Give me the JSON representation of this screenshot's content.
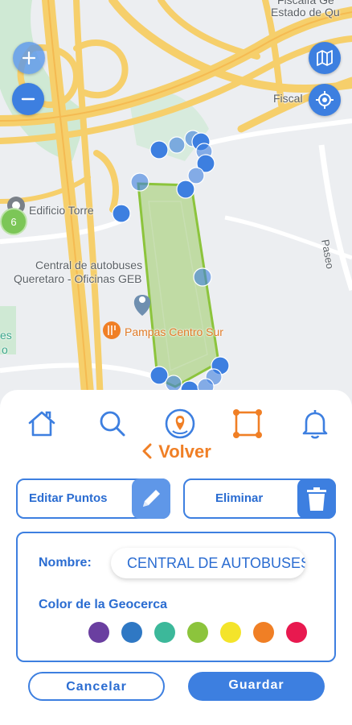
{
  "map": {
    "labels": {
      "fiscalia": "Fiscalía Ge",
      "estado": "Estado de Qu",
      "fiscal": "Fiscal",
      "edificio": "Edificio Torre",
      "central1": "Central de autobuses",
      "central2": "Queretaro - Oficinas GEB",
      "pampas": "Pampas Centro Sur",
      "paseo": "Paseo",
      "es": "es",
      "o": "o"
    },
    "cluster_count": "6",
    "polygon_fill": "#9ccc65",
    "marker_color": "#3d7fe0"
  },
  "nav": {
    "icons": [
      "home-icon",
      "search-icon",
      "geofence-pin-icon",
      "polygon-icon",
      "bell-icon"
    ]
  },
  "back": {
    "label": "Volver"
  },
  "actions": {
    "edit_label": "Editar Puntos",
    "delete_label": "Eliminar"
  },
  "form": {
    "name_label": "Nombre:",
    "name_value": "CENTRAL DE AUTOBUSES",
    "color_label": "Color de la Geocerca",
    "colors": [
      "#6a3fa0",
      "#2f78c4",
      "#3cb89a",
      "#8cc43c",
      "#f4e42a",
      "#f07f25",
      "#e8194f"
    ]
  },
  "buttons": {
    "cancel": "Cancelar",
    "save": "Guardar"
  },
  "theme": {
    "primary": "#3d7fe0",
    "accent": "#f07f25"
  }
}
